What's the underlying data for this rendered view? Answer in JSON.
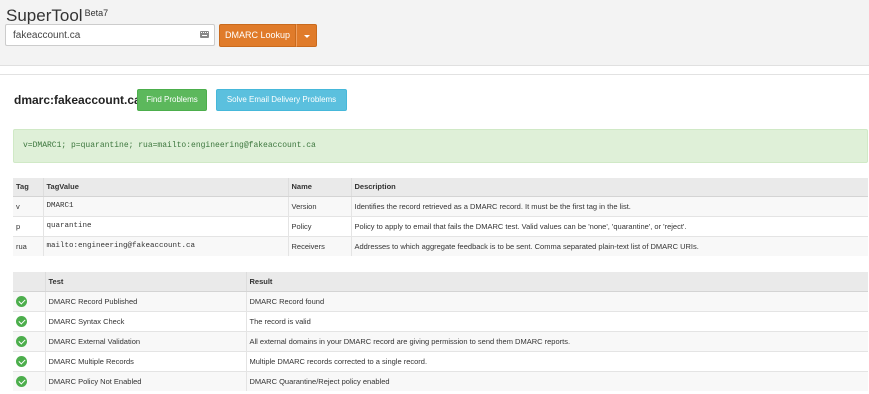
{
  "app": {
    "name": "SuperTool",
    "badge": "Beta7"
  },
  "search": {
    "value": "fakeaccount.ca",
    "icon": "keyboard-icon"
  },
  "lookup": {
    "label": "DMARC Lookup",
    "caret_icon": "caret-down-icon"
  },
  "colors": {
    "lookup": "#e07b2a",
    "green": "#5cb85c",
    "blue": "#5bc0de",
    "record_bg": "#dff0d8"
  },
  "result": {
    "title": "dmarc:fakeaccount.ca",
    "find_problems_label": "Find Problems",
    "solve_label": "Solve Email Delivery Problems",
    "record": "v=DMARC1; p=quarantine; rua=mailto:engineering@fakeaccount.ca"
  },
  "tag_table": {
    "headers": [
      "Tag",
      "TagValue",
      "Name",
      "Description"
    ],
    "rows": [
      {
        "tag": "v",
        "value": "DMARC1",
        "name": "Version",
        "description": "Identifies the record retrieved as a DMARC record. It must be the first tag in the list."
      },
      {
        "tag": "p",
        "value": "quarantine",
        "name": "Policy",
        "description": "Policy to apply to email that fails the DMARC test. Valid values can be 'none', 'quarantine', or 'reject'."
      },
      {
        "tag": "rua",
        "value": "mailto:engineering@fakeaccount.ca",
        "name": "Receivers",
        "description": "Addresses to which aggregate feedback is to be sent. Comma separated plain-text list of DMARC URIs."
      }
    ]
  },
  "test_table": {
    "headers": [
      "",
      "Test",
      "Result"
    ],
    "rows": [
      {
        "status": "pass",
        "test": "DMARC Record Published",
        "result": "DMARC Record found"
      },
      {
        "status": "pass",
        "test": "DMARC Syntax Check",
        "result": "The record is valid"
      },
      {
        "status": "pass",
        "test": "DMARC External Validation",
        "result": "All external domains in your DMARC record are giving permission to send them DMARC reports."
      },
      {
        "status": "pass",
        "test": "DMARC Multiple Records",
        "result": "Multiple DMARC records corrected to a single record."
      },
      {
        "status": "pass",
        "test": "DMARC Policy Not Enabled",
        "result": "DMARC Quarantine/Reject policy enabled"
      }
    ]
  }
}
